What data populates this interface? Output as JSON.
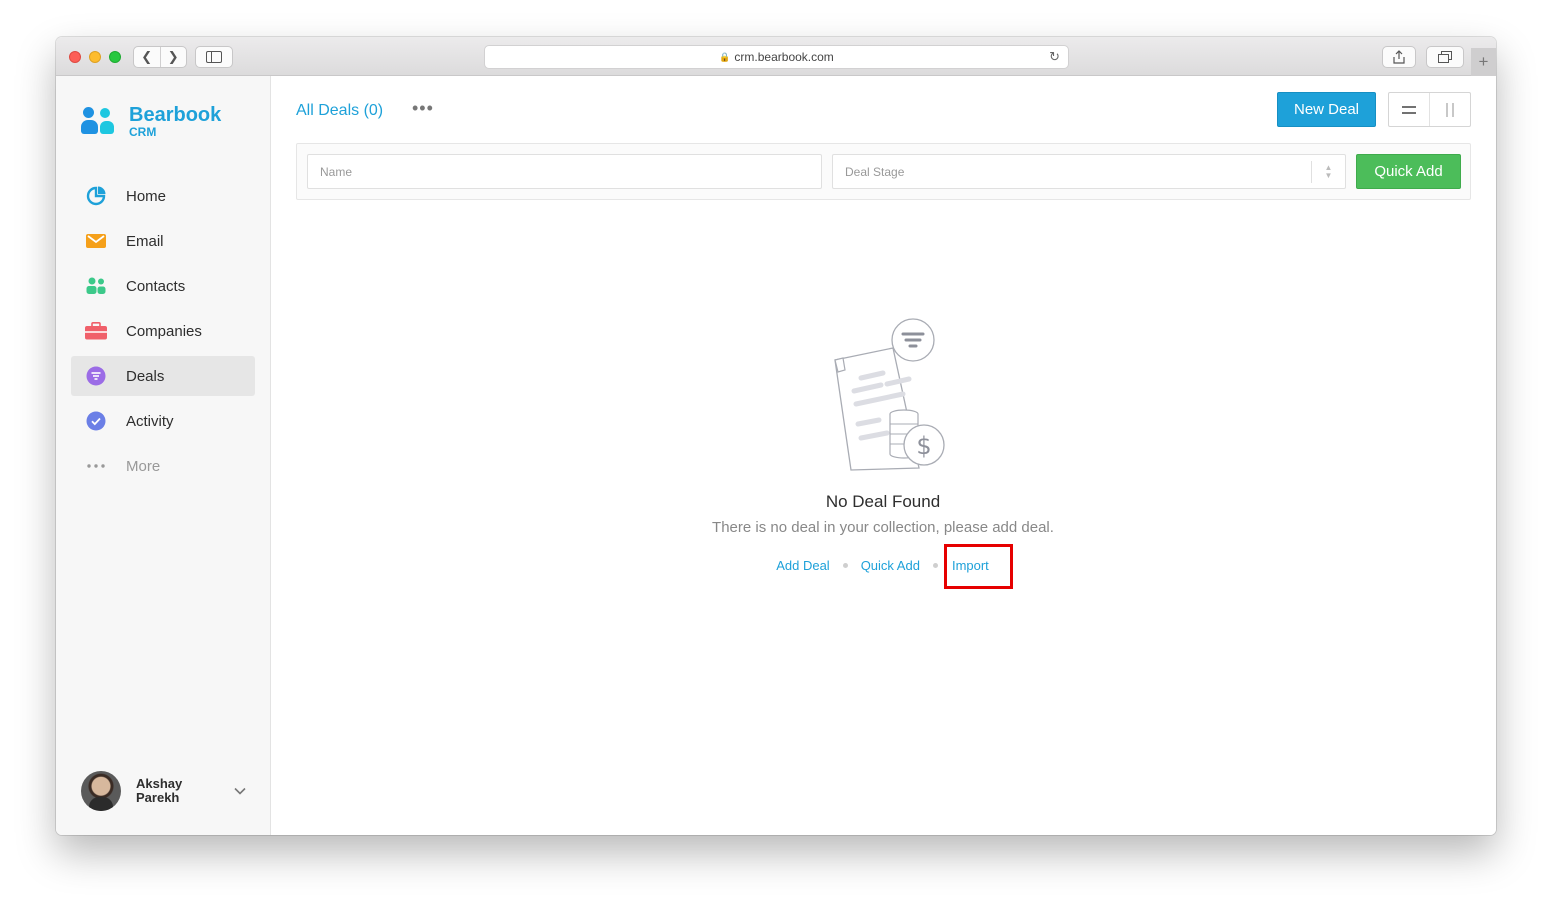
{
  "browser": {
    "url": "crm.bearbook.com",
    "new_tab_label": "+"
  },
  "app": {
    "name": "Bearbook",
    "sub": "CRM"
  },
  "sidebar": {
    "items": [
      {
        "label": "Home",
        "icon": "pie-chart-icon",
        "color": "#1ea1d9"
      },
      {
        "label": "Email",
        "icon": "mail-icon",
        "color": "#f5a01a"
      },
      {
        "label": "Contacts",
        "icon": "contacts-icon",
        "color": "#3cc98a"
      },
      {
        "label": "Companies",
        "icon": "briefcase-icon",
        "color": "#f0606a"
      },
      {
        "label": "Deals",
        "icon": "filter-icon",
        "color": "#9b6ce6",
        "active": true
      },
      {
        "label": "Activity",
        "icon": "check-icon",
        "color": "#6b7fe6"
      },
      {
        "label": "More",
        "icon": "more-dots-icon",
        "color": "#999999"
      }
    ],
    "user": {
      "first": "Akshay",
      "last": "Parekh"
    }
  },
  "header": {
    "title": "All Deals (0)",
    "new_deal_label": "New Deal"
  },
  "filters": {
    "name_placeholder": "Name",
    "stage_placeholder": "Deal Stage",
    "quick_add_label": "Quick Add"
  },
  "empty": {
    "title": "No Deal Found",
    "description": "There is no deal in your collection, please add deal.",
    "links": {
      "add": "Add Deal",
      "quick": "Quick Add",
      "import": "Import"
    }
  },
  "colors": {
    "accent": "#1ea1d9",
    "green": "#4cbd5a",
    "highlight": "#e60000"
  }
}
